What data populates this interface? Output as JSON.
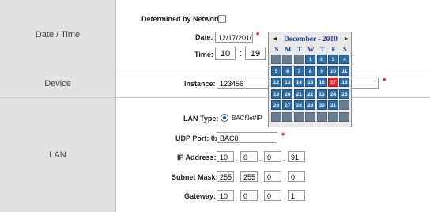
{
  "datetime": {
    "label": "Date / Time",
    "determined_label": "Determined by Network:",
    "date_label": "Date:",
    "date_value": "12/17/2010",
    "time_label": "Time:",
    "time_hour": "10",
    "time_sep": ":",
    "time_min": "19",
    "required": "*"
  },
  "calendar": {
    "prev": "◄",
    "next": "►",
    "title": "December - 2010",
    "dow": [
      "S",
      "M",
      "T",
      "W",
      "T",
      "F",
      "S"
    ],
    "weeks": [
      [
        "",
        "",
        "",
        "1",
        "2",
        "3",
        "4"
      ],
      [
        "5",
        "6",
        "7",
        "8",
        "9",
        "10",
        "11"
      ],
      [
        "12",
        "13",
        "14",
        "15",
        "16",
        "17",
        "18"
      ],
      [
        "19",
        "20",
        "21",
        "22",
        "23",
        "24",
        "25"
      ],
      [
        "26",
        "27",
        "28",
        "29",
        "30",
        "31",
        ""
      ],
      [
        "",
        "",
        "",
        "",
        "",
        "",
        ""
      ]
    ],
    "today": "17"
  },
  "device": {
    "label": "Device",
    "instance_label": "Instance:",
    "instance_value": "123456",
    "required": "*"
  },
  "lan": {
    "label": "LAN",
    "lan_type_label": "LAN Type:",
    "lan_type_value": "BACNet/IP",
    "udp_label": "UDP Port: 0x",
    "udp_value": "BAC0",
    "required": "*",
    "ip_label": "IP Address:",
    "ip": [
      "10",
      "0",
      "0",
      "91"
    ],
    "mask_label": "Subnet Mask:",
    "mask": [
      "255",
      "255",
      "0",
      "0"
    ],
    "gw_label": "Gateway:",
    "gw": [
      "10",
      "0",
      "0",
      "1"
    ],
    "dot": "."
  }
}
